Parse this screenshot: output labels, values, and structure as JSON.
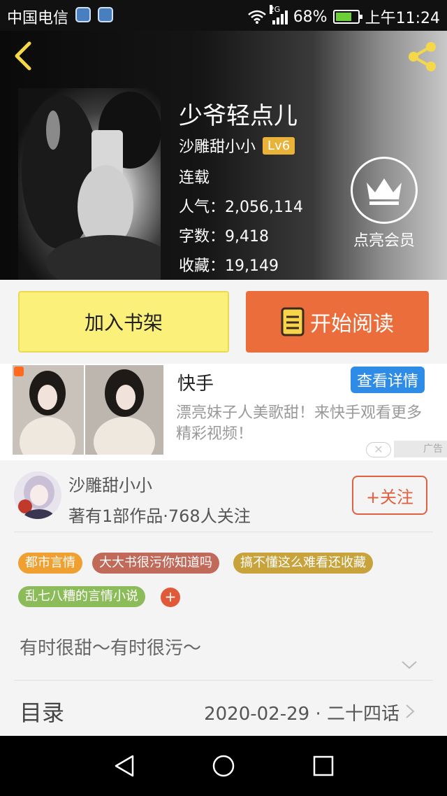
{
  "status_bar": {
    "carrier": "中国电信",
    "network": "2G",
    "battery": "68%",
    "time": "上午11:24"
  },
  "header": {
    "back_icon": "back-arrow-icon",
    "share_icon": "share-icon"
  },
  "book": {
    "title": "少爷轻点儿",
    "author": "沙雕甜小小",
    "level": "Lv6",
    "status": "连载",
    "popularity_label": "人气：",
    "popularity": "2,056,114",
    "words_label": "字数：",
    "words": "9,418",
    "favorites_label": "收藏：",
    "favorites": "19,149"
  },
  "vip": {
    "label": "点亮会员",
    "icon": "crown-icon"
  },
  "actions": {
    "add_shelf": "加入书架",
    "start_reading": "开始阅读"
  },
  "ad": {
    "brand": "快手",
    "cta": "查看详情",
    "description": "漂亮妹子人美歌甜！来快手观看更多精彩视频！",
    "close": "✕",
    "tag": "广告"
  },
  "author_card": {
    "name": "沙雕甜小小",
    "stats": "著有1部作品·768人关注",
    "follow": "+关注"
  },
  "tags": [
    {
      "label": "都市言情",
      "color": "#f0a030"
    },
    {
      "label": "大大书很污你知道吗",
      "color": "#c26a5a"
    },
    {
      "label": "搞不懂这么难看还收藏",
      "color": "#c8a23a"
    },
    {
      "label": "乱七八糟的言情小说",
      "color": "#8cbc5a"
    }
  ],
  "tag_add": "+",
  "description": "有时很甜～有时很污～",
  "toc": {
    "label": "目录",
    "info": "2020-02-29 · 二十四话"
  },
  "colors": {
    "accent_orange": "#ea6d3b",
    "shelf_yellow": "#fbf07a",
    "level_badge": "#e9b33a",
    "ad_button": "#2e8be6"
  }
}
